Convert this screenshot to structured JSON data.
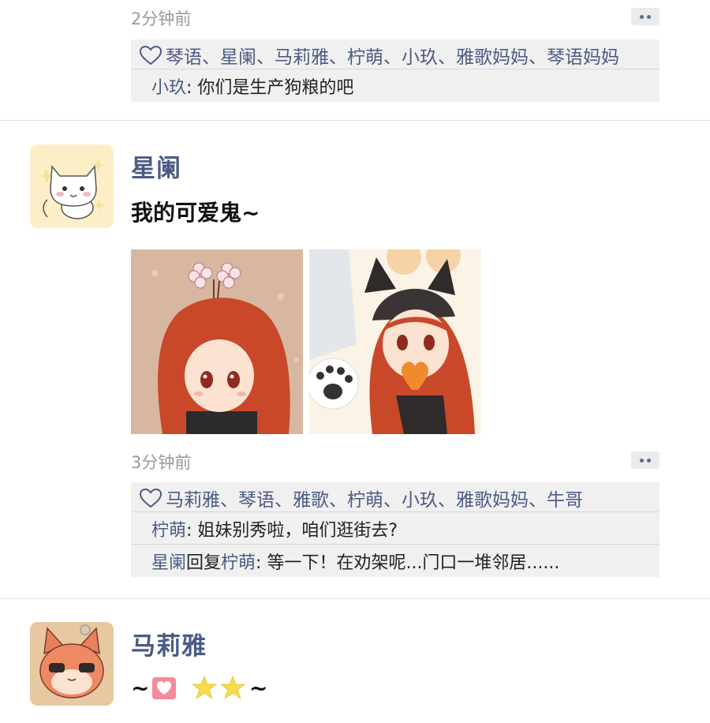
{
  "post0": {
    "time": "2分钟前",
    "likes": "琴语、星阑、马莉雅、柠萌、小玖、雅歌妈妈、琴语妈妈",
    "comments": [
      {
        "name": "小玖",
        "sep": ": ",
        "text": "你们是生产狗粮的吧"
      }
    ]
  },
  "post1": {
    "author": "星阑",
    "text": "我的可爱鬼~",
    "time": "3分钟前",
    "likes": "马莉雅、琴语、雅歌、柠萌、小玖、雅歌妈妈、牛哥",
    "comments": [
      {
        "name": "柠萌",
        "sep": ": ",
        "text": "姐妹别秀啦，咱们逛街去?"
      },
      {
        "name": "星阑",
        "reply_word": "回复",
        "reply_to": "柠萌",
        "sep": ": ",
        "text": "等一下！在劝架呢...门口一堆邻居......"
      }
    ]
  },
  "post2": {
    "author": "马莉雅",
    "text_prefix": "~",
    "text_suffix": "~"
  },
  "colors": {
    "name_blue": "#4b5b85",
    "time_gray": "#9a9a9a",
    "comment_bg": "#f0f0f0"
  },
  "icons": [
    "heart-outline-icon",
    "more-options-icon",
    "heart-emoji-icon",
    "star-emoji-icon"
  ]
}
